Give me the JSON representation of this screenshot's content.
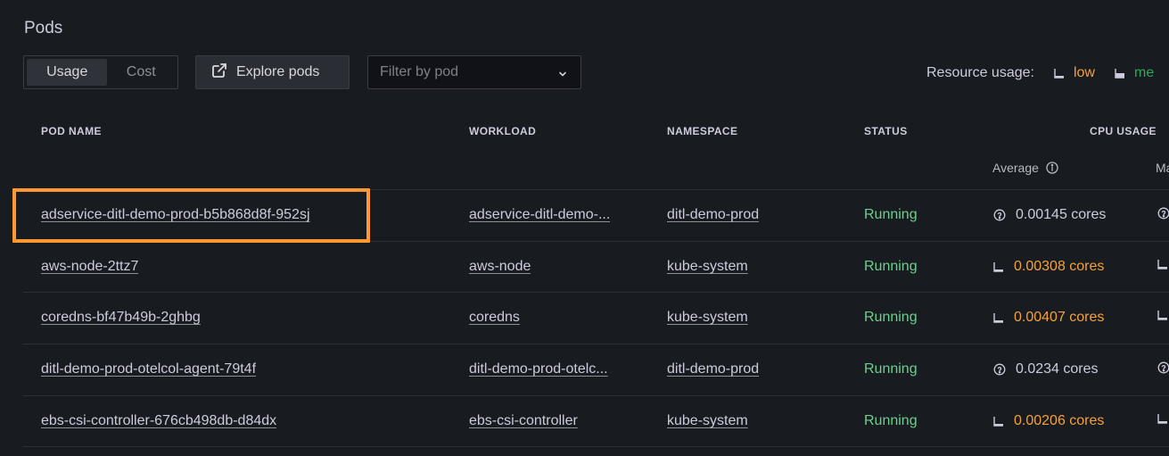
{
  "page": {
    "title": "Pods"
  },
  "toolbar": {
    "tabs": [
      {
        "label": "Usage",
        "active": true
      },
      {
        "label": "Cost",
        "active": false
      }
    ],
    "explore_label": "Explore pods",
    "filter_placeholder": "Filter by pod",
    "legend_label": "Resource usage:",
    "legend_low": "low",
    "legend_med": "me"
  },
  "table": {
    "headers": {
      "pod_name": "POD NAME",
      "workload": "WORKLOAD",
      "namespace": "NAMESPACE",
      "status": "STATUS",
      "cpu_usage": "CPU USAGE"
    },
    "subheaders": {
      "average": "Average",
      "max": "Ma"
    },
    "rows": [
      {
        "pod": "adservice-ditl-demo-prod-b5b868d8f-952sj",
        "workload": "adservice-ditl-demo-...",
        "namespace": "ditl-demo-prod",
        "status": "Running",
        "cpu_avg": "0.00145 cores",
        "level": "unknown"
      },
      {
        "pod": "aws-node-2ttz7",
        "workload": "aws-node",
        "namespace": "kube-system",
        "status": "Running",
        "cpu_avg": "0.00308 cores",
        "level": "low"
      },
      {
        "pod": "coredns-bf47b49b-2ghbg",
        "workload": "coredns",
        "namespace": "kube-system",
        "status": "Running",
        "cpu_avg": "0.00407 cores",
        "level": "low"
      },
      {
        "pod": "ditl-demo-prod-otelcol-agent-79t4f",
        "workload": "ditl-demo-prod-otelc...",
        "namespace": "ditl-demo-prod",
        "status": "Running",
        "cpu_avg": "0.0234 cores",
        "level": "unknown"
      },
      {
        "pod": "ebs-csi-controller-676cb498db-d84dx",
        "workload": "ebs-csi-controller",
        "namespace": "kube-system",
        "status": "Running",
        "cpu_avg": "0.00206 cores",
        "level": "low"
      }
    ]
  },
  "colors": {
    "background": "#181b1f",
    "low": "#f5a13b",
    "medium": "#2ea85a",
    "running": "#6ccf8e",
    "highlight": "#ff9833"
  }
}
